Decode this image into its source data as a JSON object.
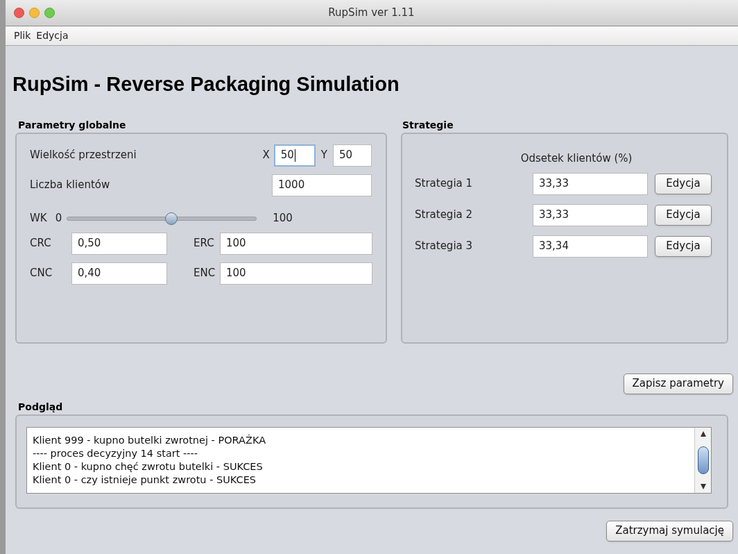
{
  "window": {
    "title": "RupSim ver 1.11"
  },
  "menu": [
    "Plik",
    "Edycja"
  ],
  "heading": "RupSim - Reverse Packaging Simulation",
  "global_params": {
    "title": "Parametry globalne",
    "space": {
      "label": "Wielkość przestrzeni",
      "x_label": "X",
      "x_value": "50",
      "x_focused": true,
      "y_label": "Y",
      "y_value": "50"
    },
    "clients": {
      "label": "Liczba klientów",
      "value": "1000"
    },
    "wk": {
      "label": "WK",
      "min": "0",
      "max": "100",
      "level": 0.55
    },
    "fields": [
      {
        "label": "CRC",
        "value": "0,50"
      },
      {
        "label": "ERC",
        "value": "100"
      },
      {
        "label": "CNC",
        "value": "0,40"
      },
      {
        "label": "ENC",
        "value": "100"
      }
    ]
  },
  "strategies": {
    "title": "Strategie",
    "column_header": "Odsetek klientów (%)",
    "rows": [
      {
        "label": "Strategia 1",
        "value": "33,33",
        "button": "Edycja"
      },
      {
        "label": "Strategia 2",
        "value": "33,33",
        "button": "Edycja"
      },
      {
        "label": "Strategia 3",
        "value": "33,34",
        "button": "Edycja"
      }
    ]
  },
  "save_button": "Zapisz parametry",
  "preview": {
    "title": "Podgląd",
    "lines": [
      "Klient 999 - kupno butelki zwrotnej - PORAŻKA",
      "---- proces decyzyjny 14 start ----",
      "Klient 0 - kupno chęć zwrotu butelki - SUKCES",
      "Klient 0 - czy istnieje punkt zwrotu - SUKCES"
    ]
  },
  "stop_button": "Zatrzymaj symulację"
}
